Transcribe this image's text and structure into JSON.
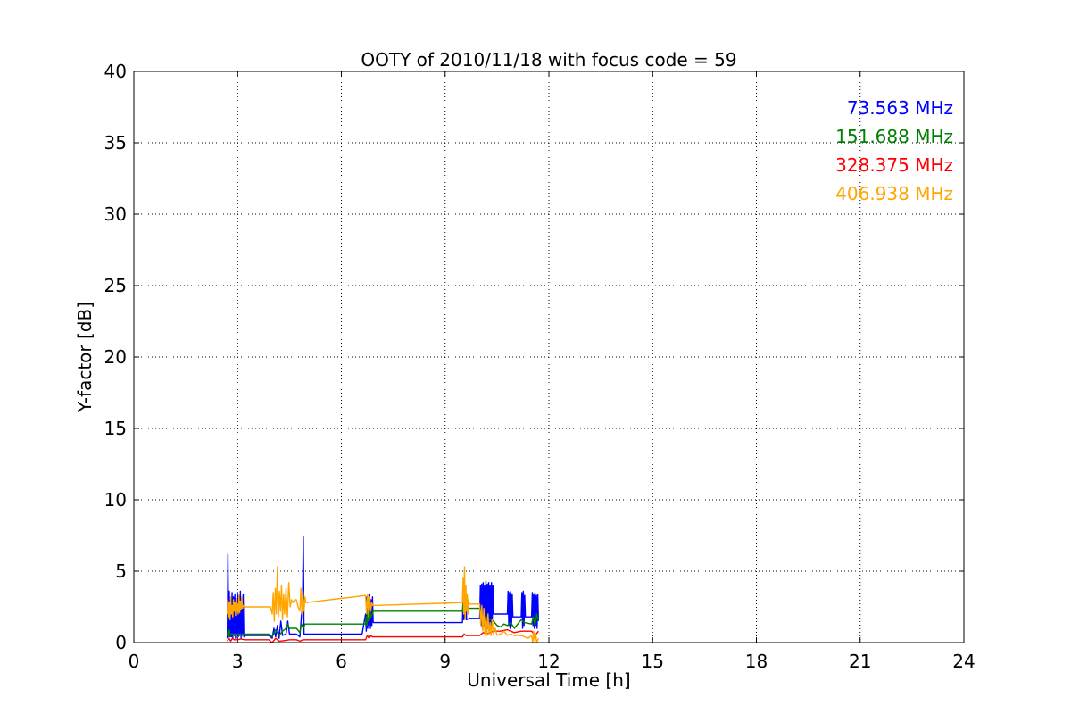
{
  "chart_data": {
    "type": "line",
    "title": "OOTY of 2010/11/18 with focus code = 59",
    "xlabel": "Universal Time [h]",
    "ylabel": "Y-factor [dB]",
    "xlim": [
      0,
      24
    ],
    "ylim": [
      0,
      40
    ],
    "xticks": [
      0,
      3,
      6,
      9,
      12,
      15,
      18,
      21,
      24
    ],
    "yticks": [
      0,
      5,
      10,
      15,
      20,
      25,
      30,
      35,
      40
    ],
    "grid": true,
    "legend_position": "top-right",
    "series": [
      {
        "name": "73.563 MHz",
        "color": "#0000ff",
        "points": [
          [
            2.7,
            0.3
          ],
          [
            2.72,
            6.2
          ],
          [
            2.74,
            0.5
          ],
          [
            2.76,
            3.6
          ],
          [
            2.78,
            0.4
          ],
          [
            2.8,
            3.0
          ],
          [
            2.82,
            0.4
          ],
          [
            2.84,
            3.5
          ],
          [
            2.86,
            0.3
          ],
          [
            2.88,
            3.2
          ],
          [
            2.9,
            0.5
          ],
          [
            2.92,
            3.4
          ],
          [
            2.94,
            0.3
          ],
          [
            2.96,
            3.0
          ],
          [
            2.98,
            0.6
          ],
          [
            3.0,
            3.5
          ],
          [
            3.02,
            0.4
          ],
          [
            3.04,
            3.3
          ],
          [
            3.06,
            0.5
          ],
          [
            3.08,
            3.6
          ],
          [
            3.1,
            0.3
          ],
          [
            3.12,
            3.1
          ],
          [
            3.14,
            0.5
          ],
          [
            3.16,
            3.4
          ],
          [
            3.18,
            0.4
          ],
          [
            3.2,
            0.5
          ],
          [
            3.9,
            0.5
          ],
          [
            4.0,
            0.3
          ],
          [
            4.05,
            1.0
          ],
          [
            4.1,
            0.4
          ],
          [
            4.15,
            1.2
          ],
          [
            4.2,
            0.3
          ],
          [
            4.25,
            1.5
          ],
          [
            4.3,
            0.5
          ],
          [
            4.4,
            0.6
          ],
          [
            4.45,
            1.5
          ],
          [
            4.5,
            0.6
          ],
          [
            4.6,
            0.6
          ],
          [
            4.7,
            0.6
          ],
          [
            4.8,
            0.4
          ],
          [
            4.88,
            3.0
          ],
          [
            4.9,
            7.4
          ],
          [
            4.92,
            0.6
          ],
          [
            4.95,
            0.6
          ],
          [
            6.6,
            0.6
          ],
          [
            6.7,
            2.0
          ],
          [
            6.72,
            0.8
          ],
          [
            6.74,
            3.2
          ],
          [
            6.76,
            1.0
          ],
          [
            6.78,
            3.0
          ],
          [
            6.8,
            1.2
          ],
          [
            6.82,
            3.4
          ],
          [
            6.84,
            1.0
          ],
          [
            6.86,
            3.0
          ],
          [
            6.88,
            1.2
          ],
          [
            6.9,
            3.2
          ],
          [
            6.92,
            1.4
          ],
          [
            9.5,
            1.4
          ],
          [
            9.52,
            3.0
          ],
          [
            9.54,
            1.6
          ],
          [
            9.56,
            3.5
          ],
          [
            9.58,
            1.8
          ],
          [
            9.6,
            3.2
          ],
          [
            9.62,
            1.6
          ],
          [
            9.7,
            1.7
          ],
          [
            10.0,
            1.7
          ],
          [
            10.02,
            4.0
          ],
          [
            10.04,
            1.2
          ],
          [
            10.06,
            4.1
          ],
          [
            10.08,
            1.0
          ],
          [
            10.1,
            4.2
          ],
          [
            10.12,
            1.2
          ],
          [
            10.14,
            4.0
          ],
          [
            10.16,
            1.0
          ],
          [
            10.18,
            4.3
          ],
          [
            10.2,
            1.2
          ],
          [
            10.22,
            4.1
          ],
          [
            10.24,
            1.0
          ],
          [
            10.26,
            4.2
          ],
          [
            10.28,
            1.2
          ],
          [
            10.3,
            4.0
          ],
          [
            10.32,
            1.1
          ],
          [
            10.34,
            4.2
          ],
          [
            10.36,
            1.3
          ],
          [
            10.38,
            4.0
          ],
          [
            10.4,
            2.0
          ],
          [
            10.8,
            2.0
          ],
          [
            10.82,
            3.6
          ],
          [
            10.84,
            1.2
          ],
          [
            10.86,
            3.5
          ],
          [
            10.88,
            1.0
          ],
          [
            10.9,
            3.6
          ],
          [
            10.92,
            1.2
          ],
          [
            10.94,
            3.4
          ],
          [
            10.96,
            1.8
          ],
          [
            11.2,
            1.8
          ],
          [
            11.22,
            3.5
          ],
          [
            11.24,
            1.0
          ],
          [
            11.26,
            3.6
          ],
          [
            11.28,
            1.2
          ],
          [
            11.3,
            3.3
          ],
          [
            11.32,
            1.8
          ],
          [
            11.5,
            1.8
          ],
          [
            11.52,
            3.5
          ],
          [
            11.54,
            1.2
          ],
          [
            11.56,
            3.4
          ],
          [
            11.58,
            1.0
          ],
          [
            11.6,
            3.5
          ],
          [
            11.62,
            1.2
          ],
          [
            11.64,
            3.3
          ],
          [
            11.66,
            1.0
          ],
          [
            11.68,
            3.4
          ],
          [
            11.7,
            1.5
          ]
        ]
      },
      {
        "name": "151.688 MHz",
        "color": "#008000",
        "points": [
          [
            2.7,
            0.5
          ],
          [
            2.72,
            0.8
          ],
          [
            2.74,
            0.4
          ],
          [
            2.76,
            0.9
          ],
          [
            2.78,
            0.5
          ],
          [
            2.8,
            0.6
          ],
          [
            3.0,
            0.6
          ],
          [
            3.2,
            0.6
          ],
          [
            3.9,
            0.6
          ],
          [
            4.0,
            0.4
          ],
          [
            4.1,
            0.9
          ],
          [
            4.2,
            0.5
          ],
          [
            4.3,
            0.8
          ],
          [
            4.4,
            1.0
          ],
          [
            4.45,
            1.3
          ],
          [
            4.5,
            1.0
          ],
          [
            4.6,
            1.0
          ],
          [
            4.7,
            1.0
          ],
          [
            4.8,
            0.7
          ],
          [
            4.85,
            1.3
          ],
          [
            4.9,
            1.0
          ],
          [
            4.95,
            1.3
          ],
          [
            6.7,
            1.3
          ],
          [
            6.72,
            1.8
          ],
          [
            6.74,
            1.2
          ],
          [
            6.76,
            2.2
          ],
          [
            6.78,
            1.5
          ],
          [
            6.8,
            2.0
          ],
          [
            6.82,
            1.6
          ],
          [
            6.84,
            2.2
          ],
          [
            6.86,
            1.8
          ],
          [
            6.9,
            2.0
          ],
          [
            6.92,
            2.2
          ],
          [
            9.5,
            2.2
          ],
          [
            9.52,
            2.8
          ],
          [
            9.54,
            2.0
          ],
          [
            9.56,
            3.0
          ],
          [
            9.58,
            2.2
          ],
          [
            9.6,
            2.5
          ],
          [
            9.7,
            2.4
          ],
          [
            10.0,
            2.4
          ],
          [
            10.05,
            2.0
          ],
          [
            10.1,
            1.6
          ],
          [
            10.2,
            1.8
          ],
          [
            10.3,
            1.6
          ],
          [
            10.4,
            1.5
          ],
          [
            10.5,
            1.2
          ],
          [
            10.6,
            1.1
          ],
          [
            10.7,
            1.3
          ],
          [
            10.8,
            1.2
          ],
          [
            10.9,
            1.4
          ],
          [
            11.0,
            1.0
          ],
          [
            11.2,
            1.6
          ],
          [
            11.3,
            1.4
          ],
          [
            11.5,
            1.3
          ],
          [
            11.55,
            1.8
          ],
          [
            11.6,
            1.2
          ],
          [
            11.65,
            2.0
          ],
          [
            11.7,
            1.5
          ]
        ]
      },
      {
        "name": "328.375 MHz",
        "color": "#ff0000",
        "points": [
          [
            2.7,
            0.1
          ],
          [
            2.75,
            0.3
          ],
          [
            2.8,
            0.1
          ],
          [
            2.85,
            0.3
          ],
          [
            2.9,
            0.2
          ],
          [
            3.0,
            0.2
          ],
          [
            3.1,
            0.25
          ],
          [
            3.2,
            0.2
          ],
          [
            3.9,
            0.2
          ],
          [
            4.0,
            0.0
          ],
          [
            4.1,
            0.3
          ],
          [
            4.2,
            0.1
          ],
          [
            4.4,
            0.15
          ],
          [
            4.5,
            0.2
          ],
          [
            4.7,
            0.2
          ],
          [
            4.8,
            0.1
          ],
          [
            4.9,
            0.2
          ],
          [
            4.95,
            0.2
          ],
          [
            6.7,
            0.2
          ],
          [
            6.75,
            0.5
          ],
          [
            6.8,
            0.3
          ],
          [
            6.85,
            0.5
          ],
          [
            6.9,
            0.4
          ],
          [
            9.5,
            0.4
          ],
          [
            9.55,
            0.6
          ],
          [
            9.6,
            0.5
          ],
          [
            9.7,
            0.5
          ],
          [
            10.0,
            0.5
          ],
          [
            10.1,
            0.7
          ],
          [
            10.2,
            0.6
          ],
          [
            10.3,
            0.7
          ],
          [
            10.4,
            0.8
          ],
          [
            10.6,
            0.8
          ],
          [
            10.8,
            0.9
          ],
          [
            11.0,
            0.7
          ],
          [
            11.2,
            0.8
          ],
          [
            11.5,
            0.8
          ],
          [
            11.6,
            0.5
          ],
          [
            11.7,
            0.8
          ]
        ]
      },
      {
        "name": "406.938 MHz",
        "color": "#ffa500",
        "points": [
          [
            2.7,
            2.0
          ],
          [
            2.72,
            3.0
          ],
          [
            2.74,
            1.8
          ],
          [
            2.76,
            2.8
          ],
          [
            2.78,
            1.6
          ],
          [
            2.8,
            3.2
          ],
          [
            2.82,
            2.0
          ],
          [
            2.84,
            2.6
          ],
          [
            2.86,
            1.8
          ],
          [
            2.88,
            3.0
          ],
          [
            2.9,
            2.2
          ],
          [
            2.92,
            2.8
          ],
          [
            2.94,
            1.9
          ],
          [
            2.96,
            3.1
          ],
          [
            2.98,
            2.2
          ],
          [
            3.0,
            2.7
          ],
          [
            3.02,
            2.0
          ],
          [
            3.04,
            3.3
          ],
          [
            3.06,
            2.1
          ],
          [
            3.08,
            2.9
          ],
          [
            3.1,
            2.3
          ],
          [
            3.12,
            3.2
          ],
          [
            3.14,
            2.4
          ],
          [
            3.16,
            2.6
          ],
          [
            3.2,
            2.5
          ],
          [
            3.95,
            2.5
          ],
          [
            4.0,
            2.0
          ],
          [
            4.03,
            3.5
          ],
          [
            4.06,
            1.5
          ],
          [
            4.09,
            3.8
          ],
          [
            4.12,
            2.0
          ],
          [
            4.15,
            5.3
          ],
          [
            4.18,
            1.8
          ],
          [
            4.21,
            3.6
          ],
          [
            4.24,
            2.2
          ],
          [
            4.27,
            4.0
          ],
          [
            4.3,
            1.6
          ],
          [
            4.33,
            3.4
          ],
          [
            4.36,
            2.0
          ],
          [
            4.4,
            3.8
          ],
          [
            4.44,
            1.8
          ],
          [
            4.48,
            4.2
          ],
          [
            4.52,
            2.5
          ],
          [
            4.56,
            3.0
          ],
          [
            4.6,
            2.8
          ],
          [
            4.65,
            3.0
          ],
          [
            4.7,
            3.0
          ],
          [
            4.75,
            2.5
          ],
          [
            4.8,
            2.2
          ],
          [
            4.83,
            3.8
          ],
          [
            4.86,
            2.0
          ],
          [
            4.89,
            3.6
          ],
          [
            4.92,
            2.2
          ],
          [
            4.95,
            3.2
          ],
          [
            4.97,
            2.8
          ],
          [
            6.7,
            3.3
          ],
          [
            6.73,
            2.0
          ],
          [
            6.76,
            3.4
          ],
          [
            6.79,
            1.8
          ],
          [
            6.82,
            3.2
          ],
          [
            6.85,
            2.2
          ],
          [
            6.88,
            2.8
          ],
          [
            6.91,
            2.6
          ],
          [
            9.5,
            2.8
          ],
          [
            9.52,
            4.5
          ],
          [
            9.54,
            2.0
          ],
          [
            9.56,
            5.3
          ],
          [
            9.58,
            1.6
          ],
          [
            9.6,
            4.0
          ],
          [
            9.62,
            2.2
          ],
          [
            9.64,
            3.4
          ],
          [
            9.66,
            2.0
          ],
          [
            9.68,
            3.0
          ],
          [
            9.7,
            2.7
          ],
          [
            10.0,
            2.7
          ],
          [
            10.03,
            1.2
          ],
          [
            10.06,
            2.6
          ],
          [
            10.09,
            0.8
          ],
          [
            10.12,
            2.4
          ],
          [
            10.15,
            0.6
          ],
          [
            10.18,
            1.8
          ],
          [
            10.21,
            0.5
          ],
          [
            10.24,
            2.0
          ],
          [
            10.27,
            0.6
          ],
          [
            10.3,
            1.4
          ],
          [
            10.33,
            0.5
          ],
          [
            10.36,
            1.6
          ],
          [
            10.4,
            0.6
          ],
          [
            10.45,
            1.0
          ],
          [
            10.5,
            0.5
          ],
          [
            10.6,
            0.6
          ],
          [
            10.7,
            0.8
          ],
          [
            10.8,
            0.5
          ],
          [
            10.9,
            0.6
          ],
          [
            11.0,
            0.5
          ],
          [
            11.2,
            0.5
          ],
          [
            11.4,
            0.3
          ],
          [
            11.5,
            0.5
          ],
          [
            11.53,
            0.0
          ],
          [
            11.56,
            0.8
          ],
          [
            11.59,
            0.1
          ],
          [
            11.62,
            0.6
          ],
          [
            11.65,
            0.0
          ],
          [
            11.7,
            0.3
          ]
        ]
      }
    ]
  }
}
